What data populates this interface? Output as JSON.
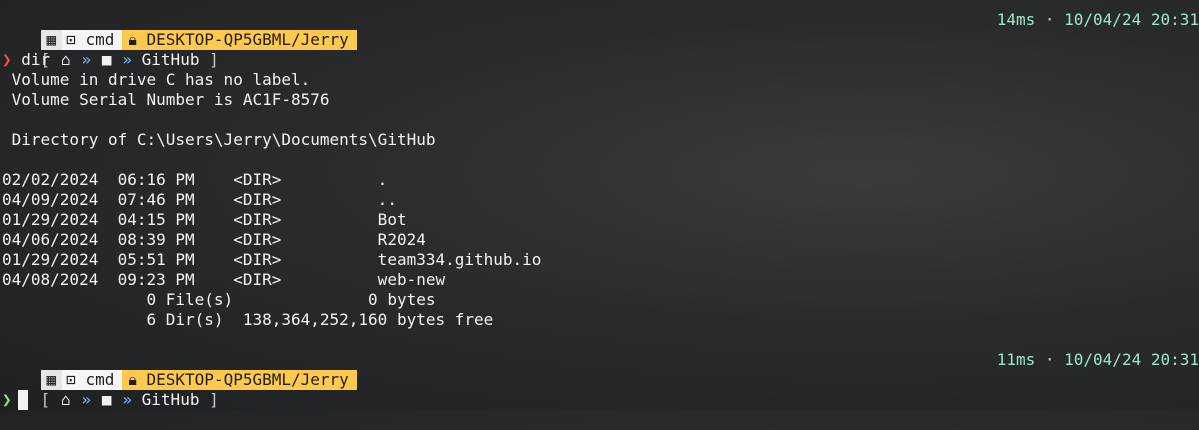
{
  "prompt": {
    "os_icon": "windows-icon",
    "shell_icon": "terminal-icon",
    "shell": "cmd",
    "lock_icon": "lock-icon",
    "host_path": "DESKTOP-QP5GBML/Jerry",
    "breadcrumb_open": "[",
    "breadcrumb_close": "]",
    "breadcrumb_sep": "»",
    "breadcrumb_home_icon": "home-icon",
    "breadcrumb_folder_icon": "folder-icon",
    "breadcrumb_dir": "GitHub",
    "chevron": "❯"
  },
  "first_prompt": {
    "duration": "14ms",
    "datetime": "10/04/24 20:31",
    "command": "dir"
  },
  "second_prompt": {
    "duration": "11ms",
    "datetime": "10/04/24 20:31"
  },
  "output": {
    "vol_label": " Volume in drive C has no label.",
    "vol_serial": " Volume Serial Number is AC1F-8576",
    "dir_of": " Directory of C:\\Users\\Jerry\\Documents\\GitHub",
    "entries": [
      {
        "date": "02/02/2024",
        "time": "06:16 PM",
        "type": "<DIR>",
        "name": "."
      },
      {
        "date": "04/09/2024",
        "time": "07:46 PM",
        "type": "<DIR>",
        "name": ".."
      },
      {
        "date": "01/29/2024",
        "time": "04:15 PM",
        "type": "<DIR>",
        "name": "Bot"
      },
      {
        "date": "04/06/2024",
        "time": "08:39 PM",
        "type": "<DIR>",
        "name": "R2024"
      },
      {
        "date": "01/29/2024",
        "time": "05:51 PM",
        "type": "<DIR>",
        "name": "team334.github.io"
      },
      {
        "date": "04/08/2024",
        "time": "09:23 PM",
        "type": "<DIR>",
        "name": "web-new"
      }
    ],
    "files_summary": "               0 File(s)              0 bytes",
    "dirs_summary": "               6 Dir(s)  138,364,252,160 bytes free"
  }
}
